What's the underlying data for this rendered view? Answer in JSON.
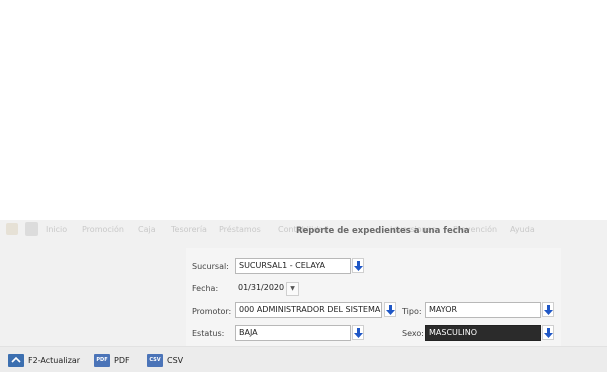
{
  "menu": {
    "items": [
      "Inicio",
      "Promoción",
      "Caja",
      "Tesorería",
      "Préstamos",
      "Contabilidad",
      "Inversiones",
      "Prevención",
      "Ayuda"
    ]
  },
  "window": {
    "title": "Reporte de expedientes a una fecha"
  },
  "form": {
    "sucursal": {
      "label": "Sucursal:",
      "value": "SUCURSAL1 - CELAYA"
    },
    "fecha": {
      "label": "Fecha:",
      "value": "01/31/2020"
    },
    "promotor": {
      "label": "Promotor:",
      "value": "000 ADMINISTRADOR DEL SISTEMA"
    },
    "tipo": {
      "label": "Tipo:",
      "value": "MAYOR"
    },
    "estatus": {
      "label": "Estatus:",
      "value": "BAJA"
    },
    "sexo": {
      "label": "Sexo:",
      "value": "MASCULINO"
    }
  },
  "toolbar": {
    "refresh_label": "F2-Actualizar",
    "pdf_label": "PDF",
    "pdf_icon_text": "PDF",
    "csv_label": "CSV",
    "csv_icon_text": "CSV"
  },
  "colors": {
    "accent": "#1f57c6",
    "menu_bg": "#f1f1f1",
    "selected_field": "#2b2b2b"
  }
}
